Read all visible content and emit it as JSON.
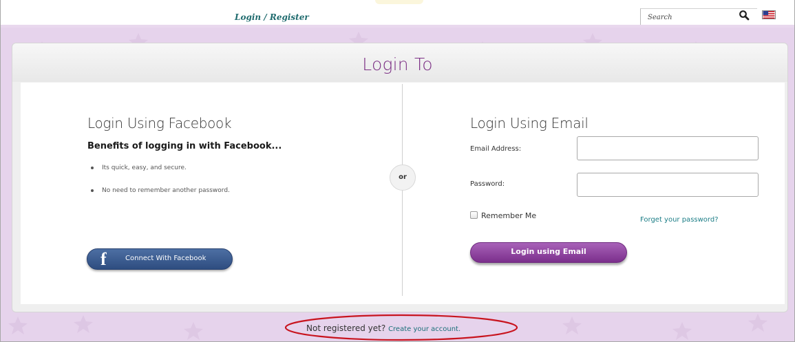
{
  "topbar": {
    "login_register_link": "Login / Register",
    "search_placeholder": "Search",
    "search_icon": "magnifier-icon",
    "flag_icon": "us-flag-icon"
  },
  "panel": {
    "title": "Login To",
    "or_label": "or"
  },
  "facebook": {
    "heading": "Login Using Facebook",
    "subheading": "Benefits of logging in with Facebook...",
    "benefits": [
      "Its quick, easy, and secure.",
      "No need to remember another password."
    ],
    "button_label": "Connect With Facebook",
    "icon": "facebook-f-icon"
  },
  "email_login": {
    "heading": "Login Using Email",
    "email_label": "Email Address:",
    "email_value": "",
    "password_label": "Password:",
    "password_value": "",
    "remember_label": "Remember Me",
    "remember_checked": false,
    "forgot_link": "Forget your password?",
    "button_label": "Login using Email"
  },
  "footer": {
    "not_registered": "Not registered yet?",
    "create_link": "Create your account."
  },
  "colors": {
    "brand_purple": "#7b2e84",
    "link_teal": "#1b7d86",
    "background_lilac": "#e6d3ec",
    "facebook_blue": "#3b5b8f",
    "highlight_red": "#c8141e"
  }
}
